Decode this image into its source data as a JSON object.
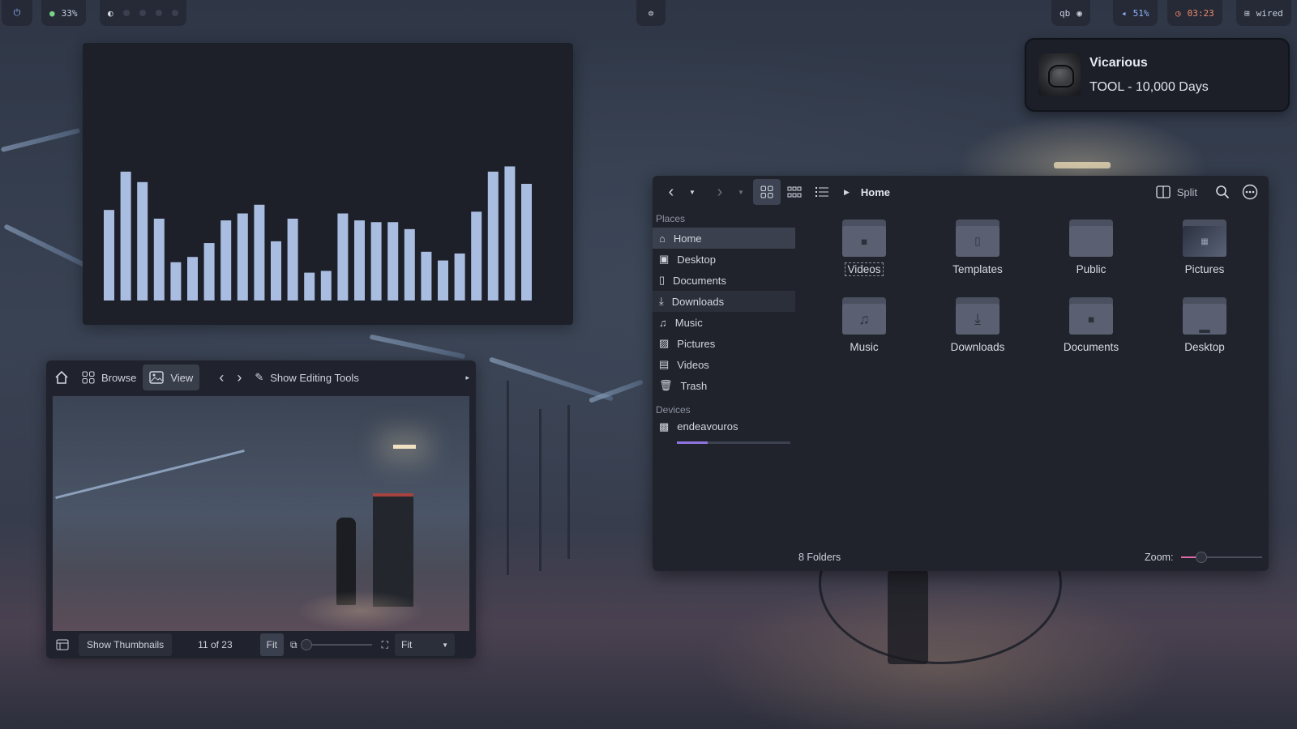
{
  "topbar": {
    "cpu": "33%",
    "qb_label": "qb",
    "volume": "51%",
    "clock": "03:23",
    "network": "wired"
  },
  "visualizer": {
    "levels": [
      0.52,
      0.74,
      0.68,
      0.47,
      0.22,
      0.25,
      0.33,
      0.46,
      0.5,
      0.55,
      0.34,
      0.47,
      0.16,
      0.17,
      0.5,
      0.46,
      0.45,
      0.45,
      0.41,
      0.28,
      0.23,
      0.27,
      0.51,
      0.74,
      0.77,
      0.67
    ],
    "bar_color": "#a9bde0"
  },
  "now_playing": {
    "title": "Vicarious",
    "artist_album": "TOOL - 10,000 Days"
  },
  "image_viewer": {
    "browse_label": "Browse",
    "view_label": "View",
    "editing_label": "Show Editing Tools",
    "thumbnails_label": "Show Thumbnails",
    "counter": "11 of 23",
    "fit_button": "Fit",
    "fit_select": "Fit"
  },
  "file_manager": {
    "breadcrumb": "Home",
    "split_label": "Split",
    "places_header": "Places",
    "places": [
      {
        "label": "Home",
        "icon": "home-icon"
      },
      {
        "label": "Desktop",
        "icon": "desktop-icon"
      },
      {
        "label": "Documents",
        "icon": "document-icon"
      },
      {
        "label": "Downloads",
        "icon": "download-icon"
      },
      {
        "label": "Music",
        "icon": "music-icon"
      },
      {
        "label": "Pictures",
        "icon": "image-icon"
      },
      {
        "label": "Videos",
        "icon": "video-icon"
      },
      {
        "label": "Trash",
        "icon": "trash-icon"
      }
    ],
    "devices_header": "Devices",
    "devices": [
      {
        "label": "endeavouros",
        "usage": 0.27
      }
    ],
    "folders": [
      {
        "label": "Videos",
        "icon": "video-icon"
      },
      {
        "label": "Templates",
        "icon": "template-icon"
      },
      {
        "label": "Public",
        "icon": "folder-icon"
      },
      {
        "label": "Pictures",
        "icon": "image-icon"
      },
      {
        "label": "Music",
        "icon": "music-icon"
      },
      {
        "label": "Downloads",
        "icon": "download-icon"
      },
      {
        "label": "Documents",
        "icon": "document-icon"
      },
      {
        "label": "Desktop",
        "icon": "desktop-icon"
      }
    ],
    "status": "8 Folders",
    "zoom_label": "Zoom:",
    "zoom_level": 0.25,
    "accent": "#e06aa8"
  }
}
